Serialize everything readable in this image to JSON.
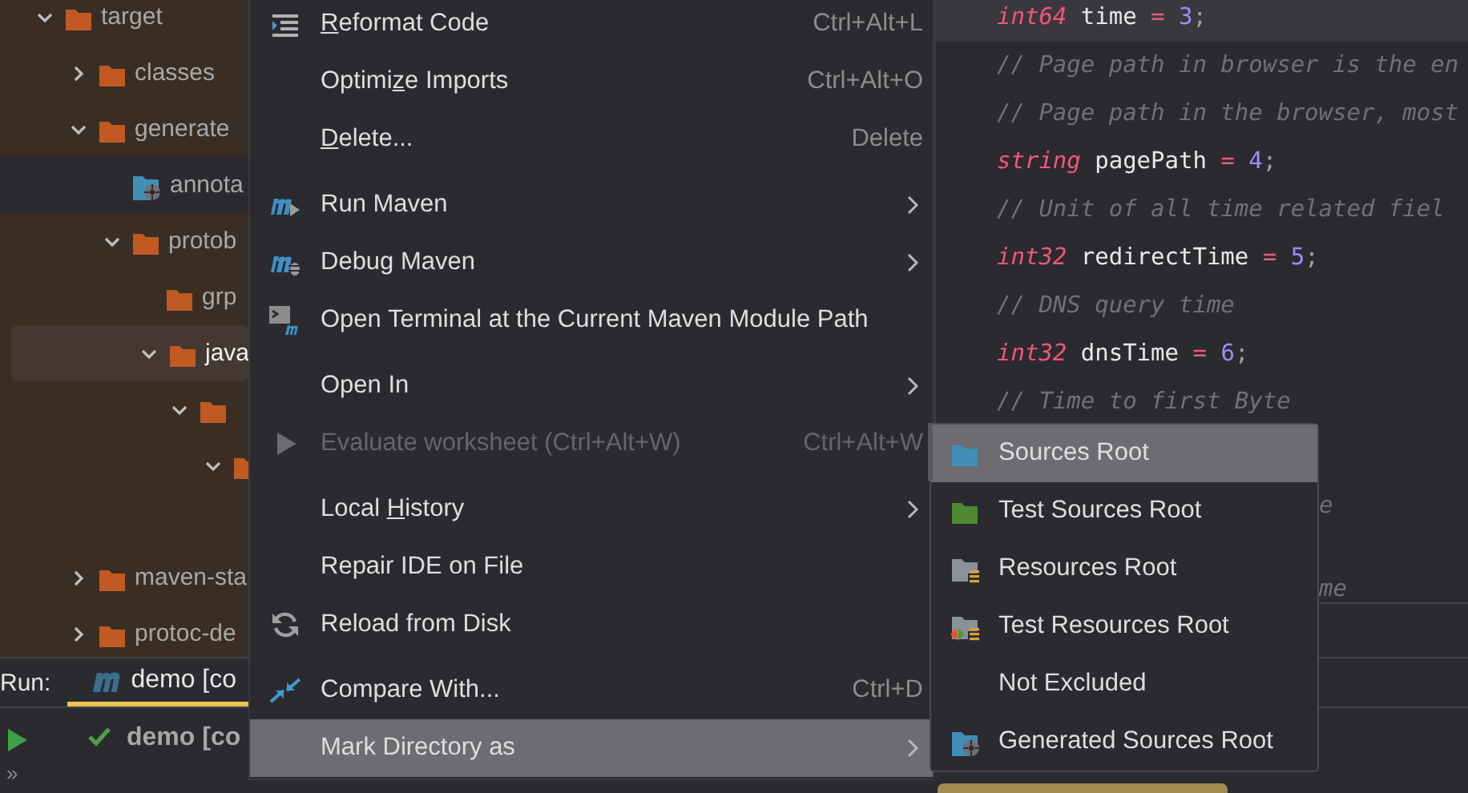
{
  "project_tree": {
    "items": [
      {
        "label": "target",
        "kind": "folder",
        "expanded": true,
        "selected": false,
        "highlighted": false,
        "children": [
          {
            "label": "classes",
            "kind": "folder",
            "expanded": false,
            "selected": false,
            "highlighted": false
          },
          {
            "label": "generate",
            "kind": "folder",
            "expanded": true,
            "selected": false,
            "highlighted": false,
            "children": [
              {
                "label": "annota",
                "kind": "generated",
                "selected": true,
                "highlighted": false
              },
              {
                "label": "protob",
                "kind": "folder",
                "expanded": true,
                "selected": false,
                "highlighted": false,
                "children": [
                  {
                    "label": "grp",
                    "kind": "folder",
                    "selected": false,
                    "highlighted": false
                  },
                  {
                    "label": "java",
                    "kind": "folder",
                    "expanded": true,
                    "selected": false,
                    "highlighted": true,
                    "children": [
                      {
                        "kind": "folder",
                        "expanded": true,
                        "selected": false,
                        "highlighted": false,
                        "children": [
                          {
                            "kind": "folder-edge",
                            "expanded": true,
                            "selected": false,
                            "highlighted": false
                          }
                        ]
                      }
                    ]
                  }
                ]
              }
            ]
          },
          {
            "label": "maven-sta",
            "kind": "folder",
            "expanded": false,
            "selected": false,
            "highlighted": false
          },
          {
            "label": "protoc-de",
            "kind": "folder",
            "expanded": false,
            "selected": false,
            "highlighted": false
          }
        ]
      }
    ]
  },
  "editor": {
    "lines": [
      {
        "current": true,
        "tokens": [
          {
            "kind": "keyword",
            "text": "int64"
          },
          {
            "kind": "ident",
            "text": " time "
          },
          {
            "kind": "op",
            "text": "="
          },
          {
            "kind": "number",
            "text": " 3"
          },
          {
            "kind": "punct",
            "text": ";"
          }
        ]
      },
      {
        "current": false,
        "tokens": [
          {
            "kind": "comment",
            "text": "// Page path in browser is the en"
          }
        ]
      },
      {
        "current": false,
        "tokens": [
          {
            "kind": "comment",
            "text": "// Page path in the browser, most"
          }
        ]
      },
      {
        "current": false,
        "tokens": [
          {
            "kind": "keyword",
            "text": "string"
          },
          {
            "kind": "ident",
            "text": " pagePath "
          },
          {
            "kind": "op",
            "text": "="
          },
          {
            "kind": "number",
            "text": " 4"
          },
          {
            "kind": "punct",
            "text": ";"
          }
        ]
      },
      {
        "current": false,
        "tokens": [
          {
            "kind": "comment",
            "text": "// Unit of all time related fiel"
          }
        ]
      },
      {
        "current": false,
        "tokens": [
          {
            "kind": "keyword",
            "text": "int32"
          },
          {
            "kind": "ident",
            "text": " redirectTime "
          },
          {
            "kind": "op",
            "text": "="
          },
          {
            "kind": "number",
            "text": " 5"
          },
          {
            "kind": "punct",
            "text": ";"
          }
        ]
      },
      {
        "current": false,
        "tokens": [
          {
            "kind": "comment",
            "text": "// DNS query time"
          }
        ]
      },
      {
        "current": false,
        "tokens": [
          {
            "kind": "keyword",
            "text": "int32"
          },
          {
            "kind": "ident",
            "text": " dnsTime "
          },
          {
            "kind": "op",
            "text": "="
          },
          {
            "kind": "number",
            "text": " 6"
          },
          {
            "kind": "punct",
            "text": ";"
          }
        ]
      },
      {
        "current": false,
        "tokens": [
          {
            "kind": "comment",
            "text": "// Time to first Byte"
          }
        ]
      }
    ],
    "fragments": [
      "e",
      "me"
    ]
  },
  "run_panel": {
    "label": "Run:",
    "tab": {
      "title": "demo [co",
      "selected": true
    },
    "entry": {
      "title": "demo [co",
      "success": true
    },
    "more": "»"
  },
  "context_menu": {
    "items": [
      {
        "kind": "reformat",
        "label_parts": {
          "key": "R",
          "post": "eformat Code"
        },
        "shortcut": "Ctrl+Alt+L",
        "submenu": false,
        "disabled": false,
        "selected": false
      },
      {
        "kind": "plain",
        "label_parts": {
          "pre": "Optimi",
          "key": "z",
          "post": "e Imports"
        },
        "shortcut": "Ctrl+Alt+O",
        "submenu": false,
        "disabled": false,
        "selected": false
      },
      {
        "kind": "plain",
        "label_parts": {
          "key": "D",
          "post": "elete..."
        },
        "shortcut": "Delete",
        "submenu": false,
        "disabled": false,
        "selected": false
      },
      {
        "kind": "separator"
      },
      {
        "kind": "maven-run",
        "label": "Run Maven",
        "submenu": true,
        "disabled": false,
        "selected": false
      },
      {
        "kind": "maven-debug",
        "label": "Debug Maven",
        "submenu": true,
        "disabled": false,
        "selected": false
      },
      {
        "kind": "terminal",
        "label": "Open Terminal at the Current Maven Module Path",
        "submenu": false,
        "disabled": false,
        "selected": false
      },
      {
        "kind": "separator"
      },
      {
        "kind": "plain",
        "label": "Open In",
        "submenu": true,
        "disabled": false,
        "selected": false
      },
      {
        "kind": "play",
        "label": "Evaluate worksheet (Ctrl+Alt+W)",
        "shortcut": "Ctrl+Alt+W",
        "submenu": false,
        "disabled": true,
        "selected": false
      },
      {
        "kind": "separator"
      },
      {
        "kind": "plain",
        "label_parts": {
          "pre": "Local ",
          "key": "H",
          "post": "istory"
        },
        "submenu": true,
        "disabled": false,
        "selected": false
      },
      {
        "kind": "plain",
        "label": "Repair IDE on File",
        "submenu": false,
        "disabled": false,
        "selected": false
      },
      {
        "kind": "reload",
        "label": "Reload from Disk",
        "submenu": false,
        "disabled": false,
        "selected": false
      },
      {
        "kind": "separator"
      },
      {
        "kind": "compare",
        "label": "Compare With...",
        "shortcut": "Ctrl+D",
        "submenu": false,
        "disabled": false,
        "selected": false
      },
      {
        "kind": "plain",
        "label": "Mark Directory as",
        "submenu": true,
        "disabled": false,
        "selected": true
      }
    ]
  },
  "submenu": {
    "items": [
      {
        "kind": "sources",
        "label": "Sources Root",
        "selected": true
      },
      {
        "kind": "test-sources",
        "label": "Test Sources Root",
        "selected": false
      },
      {
        "kind": "resources",
        "label": "Resources Root",
        "selected": false
      },
      {
        "kind": "test-resources",
        "label": "Test Resources Root",
        "selected": false
      },
      {
        "kind": "plain",
        "label": "Not Excluded",
        "selected": false
      },
      {
        "kind": "generated",
        "label": "Generated Sources Root",
        "selected": false
      }
    ]
  }
}
